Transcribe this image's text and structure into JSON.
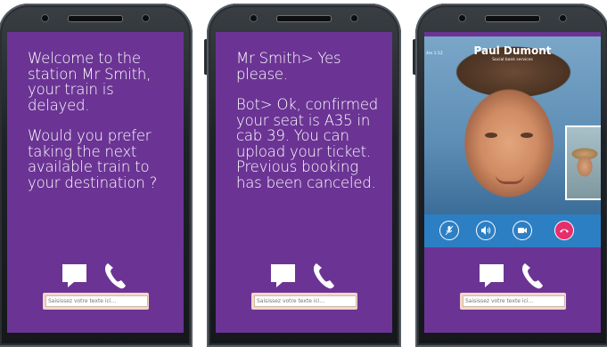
{
  "phones": [
    {
      "message": [
        "Welcome to the station Mr Smith, your train is delayed.",
        "Would you prefer taking the next available train to your destination ?"
      ],
      "input_placeholder": "Saisissez votre texte ici..."
    },
    {
      "message": [
        "Mr Smith> Yes please.",
        "Bot> Ok, confirmed your seat is A35 in cab 39. You can upload your ticket. Previous booking has been canceled."
      ],
      "input_placeholder": "Saisissez votre texte ici..."
    },
    {
      "call": {
        "caller_name": "Paul Dumont",
        "caller_subtitle": "Social bank services",
        "elapsed": "4m 1:12",
        "controls": [
          "mute-mic-icon",
          "speaker-icon",
          "video-camera-icon",
          "end-call-icon"
        ]
      },
      "input_placeholder": "Saisissez votre texte ici..."
    }
  ],
  "colors": {
    "screen_background": "#6b3494",
    "text": "#ffffff",
    "call_bar": "#2d7fc4",
    "end_call": "#e62e6b",
    "input_border": "#f6d5c5"
  },
  "icons": [
    "chat-bubble-icon",
    "phone-call-icon"
  ]
}
